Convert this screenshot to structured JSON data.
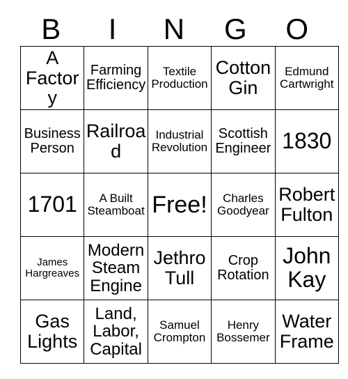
{
  "card": {
    "title_letters": [
      "B",
      "I",
      "N",
      "G",
      "O"
    ],
    "columns": [
      {
        "letter": "B",
        "cells": [
          {
            "text": "A Factory",
            "size": "xl"
          },
          {
            "text": "Business Person",
            "size": "md"
          },
          {
            "text": "1701",
            "size": "xxl"
          },
          {
            "text": "James Hargreaves",
            "size": "xs"
          },
          {
            "text": "Gas Lights",
            "size": "xl"
          }
        ]
      },
      {
        "letter": "I",
        "cells": [
          {
            "text": "Farming Efficiency",
            "size": "md"
          },
          {
            "text": "Railroad",
            "size": "xl"
          },
          {
            "text": "A Built Steamboat",
            "size": "sm"
          },
          {
            "text": "Modern Steam Engine",
            "size": "lg"
          },
          {
            "text": "Land, Labor, Capital",
            "size": "lg"
          }
        ]
      },
      {
        "letter": "N",
        "cells": [
          {
            "text": "Textile Production",
            "size": "sm"
          },
          {
            "text": "Industrial Revolution",
            "size": "sm"
          },
          {
            "text": "Free!",
            "size": "free"
          },
          {
            "text": "Jethro Tull",
            "size": "xl"
          },
          {
            "text": "Samuel Crompton",
            "size": "sm"
          }
        ]
      },
      {
        "letter": "G",
        "cells": [
          {
            "text": "Cotton Gin",
            "size": "xl"
          },
          {
            "text": "Scottish Engineer",
            "size": "md"
          },
          {
            "text": "Charles Goodyear",
            "size": "sm"
          },
          {
            "text": "Crop Rotation",
            "size": "md"
          },
          {
            "text": "Henry Bossemer",
            "size": "sm"
          }
        ]
      },
      {
        "letter": "O",
        "cells": [
          {
            "text": "Edmund Cartwright",
            "size": "sm"
          },
          {
            "text": "1830",
            "size": "xxl"
          },
          {
            "text": "Robert Fulton",
            "size": "xl"
          },
          {
            "text": "John Kay",
            "size": "xxl"
          },
          {
            "text": "Water Frame",
            "size": "xl"
          }
        ]
      }
    ],
    "rows": [
      [
        {
          "text": "A Factory",
          "size": "xl"
        },
        {
          "text": "Farming Efficiency",
          "size": "md"
        },
        {
          "text": "Textile Production",
          "size": "sm"
        },
        {
          "text": "Cotton Gin",
          "size": "xl"
        },
        {
          "text": "Edmund Cartwright",
          "size": "sm"
        }
      ],
      [
        {
          "text": "Business Person",
          "size": "md"
        },
        {
          "text": "Railroad",
          "size": "xl"
        },
        {
          "text": "Industrial Revolution",
          "size": "sm"
        },
        {
          "text": "Scottish Engineer",
          "size": "md"
        },
        {
          "text": "1830",
          "size": "xxl"
        }
      ],
      [
        {
          "text": "1701",
          "size": "xxl"
        },
        {
          "text": "A Built Steamboat",
          "size": "sm"
        },
        {
          "text": "Free!",
          "size": "free"
        },
        {
          "text": "Charles Goodyear",
          "size": "sm"
        },
        {
          "text": "Robert Fulton",
          "size": "xl"
        }
      ],
      [
        {
          "text": "James Hargreaves",
          "size": "xs"
        },
        {
          "text": "Modern Steam Engine",
          "size": "lg"
        },
        {
          "text": "Jethro Tull",
          "size": "xl"
        },
        {
          "text": "Crop Rotation",
          "size": "md"
        },
        {
          "text": "John Kay",
          "size": "xxl"
        }
      ],
      [
        {
          "text": "Gas Lights",
          "size": "xl"
        },
        {
          "text": "Land, Labor, Capital",
          "size": "lg"
        },
        {
          "text": "Samuel Crompton",
          "size": "sm"
        },
        {
          "text": "Henry Bossemer",
          "size": "sm"
        },
        {
          "text": "Water Frame",
          "size": "xl"
        }
      ]
    ],
    "colors": {
      "background": "#ffffff",
      "text": "#000000",
      "border": "#000000"
    }
  }
}
